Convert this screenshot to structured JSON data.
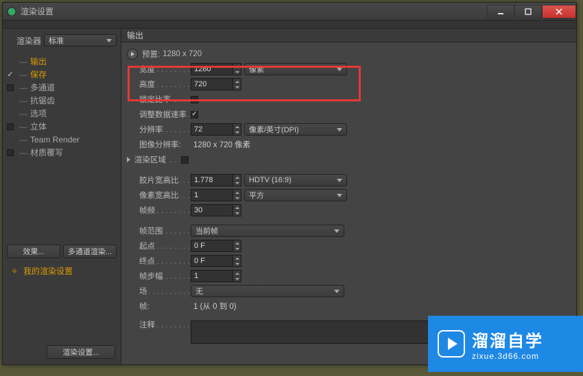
{
  "window": {
    "title": "渲染设置"
  },
  "win_controls": {
    "min": "minimize",
    "max": "maximize",
    "close": "close"
  },
  "renderer": {
    "label": "渲染器",
    "value": "标准"
  },
  "sidebar": {
    "items": [
      {
        "label": "输出",
        "selected": true,
        "checkbox": false,
        "checked": false
      },
      {
        "label": "保存",
        "checkbox": true,
        "checked": true,
        "highlighted": true
      },
      {
        "label": "多通道",
        "checkbox": true,
        "checked": false
      },
      {
        "label": "抗锯齿",
        "checkbox": false
      },
      {
        "label": "选项",
        "checkbox": false
      },
      {
        "label": "立体",
        "checkbox": true,
        "checked": false
      },
      {
        "label": "Team Render",
        "checkbox": false
      },
      {
        "label": "材质覆写",
        "checkbox": true,
        "checked": false
      }
    ]
  },
  "buttons": {
    "effects": "效果...",
    "multipass": "多通道渲染...",
    "render_settings": "渲染设置..."
  },
  "my_settings": {
    "label": "我的渲染设置"
  },
  "output": {
    "title": "输出",
    "preset_label": "预置:",
    "preset_value": "1280 x 720",
    "width_label": "宽度",
    "width_value": "1280",
    "height_label": "高度",
    "height_value": "720",
    "unit": "像素",
    "lock_label": "锁定比率",
    "lock_checked": false,
    "adjust_label": "调整数据速率",
    "adjust_checked": true,
    "resolution_label": "分辨率",
    "resolution_value": "72",
    "resolution_unit": "像素/英寸(DPI)",
    "image_res_label": "图像分辨率:",
    "image_res_value": "1280 x 720 像素",
    "render_region_label": "渲染区域",
    "render_region_checked": false,
    "film_aspect_label": "胶片宽高比",
    "film_aspect_value": "1.778",
    "film_aspect_preset": "HDTV (16:9)",
    "pixel_aspect_label": "像素宽高比",
    "pixel_aspect_value": "1",
    "pixel_aspect_preset": "平方",
    "fps_label": "帧频",
    "fps_value": "30",
    "frame_range_label": "帧范围",
    "frame_range_value": "当前帧",
    "start_label": "起点",
    "start_value": "0 F",
    "end_label": "终点",
    "end_value": "0 F",
    "step_label": "帧步幅",
    "step_value": "1",
    "field_label": "场",
    "field_value": "无",
    "frames_label": "帧:",
    "frames_value": "1 (从 0 到 0)",
    "comment_label": "注释"
  },
  "watermark": {
    "brand": "溜溜自学",
    "url": "zixue.3d66.com"
  }
}
